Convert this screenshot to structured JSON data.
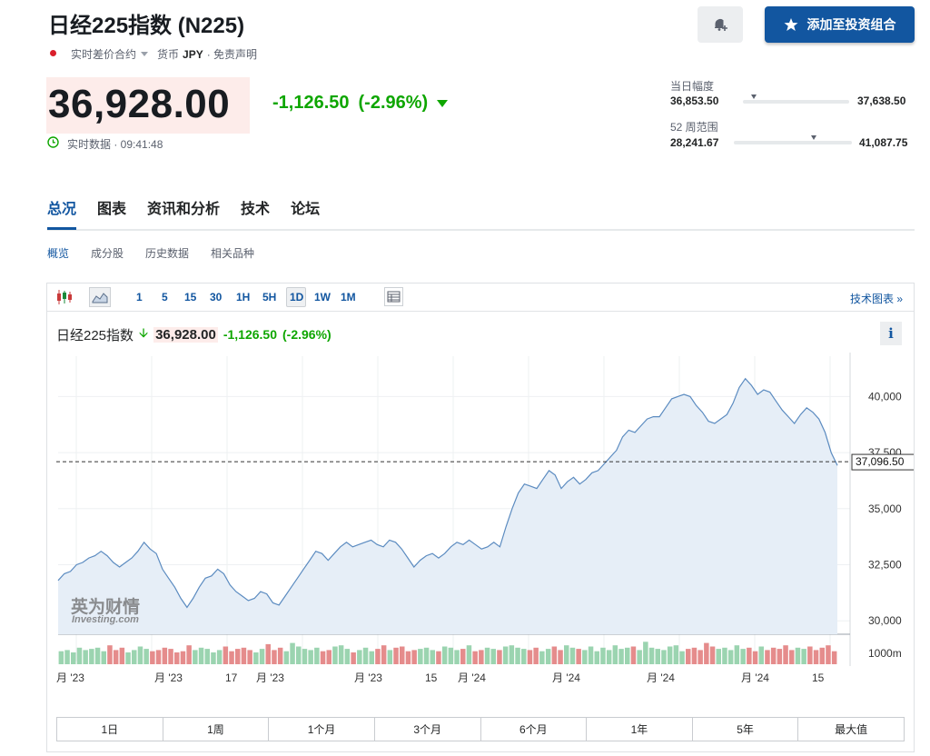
{
  "header": {
    "title": "日经225指数 (N225)",
    "instrument_type": "实时差价合约",
    "currency_label": "货币",
    "currency": "JPY",
    "disclaimer": "· 免责声明",
    "add_portfolio": "添加至投资组合"
  },
  "quote": {
    "price": "36,928.00",
    "change": "-1,126.50",
    "change_pct": "(-2.96%)",
    "realtime": "实时数据 · 09:41:48"
  },
  "ranges": {
    "day_label": "当日幅度",
    "day_low": "36,853.50",
    "day_high": "37,638.50",
    "day_position": 0.1,
    "week52_label": "52 周范围",
    "week52_low": "28,241.67",
    "week52_high": "41,087.75",
    "week52_position": 0.68
  },
  "tabs": [
    "总况",
    "图表",
    "资讯和分析",
    "技术",
    "论坛"
  ],
  "subtabs": [
    "概览",
    "成分股",
    "历史数据",
    "相关品种"
  ],
  "toolbar": {
    "timeframes": [
      "1",
      "5",
      "15",
      "30",
      "1H",
      "5H",
      "1D",
      "1W",
      "1M"
    ],
    "active": "1D",
    "tech_chart": "技术图表 »"
  },
  "chart_head": {
    "name": "日经225指数",
    "price": "36,928.00",
    "change": "-1,126.50",
    "change_pct": "(-2.96%)"
  },
  "watermark": {
    "cn": "英为财情",
    "en": "Investing.com"
  },
  "range_buttons": [
    "1日",
    "1周",
    "1个月",
    "3个月",
    "6个月",
    "1年",
    "5年",
    "最大值"
  ],
  "colors": {
    "accent": "#1256a0",
    "down": "#0ea600",
    "up_volume": "#e05a5a"
  },
  "chart_data": {
    "type": "area",
    "y_ticks": [
      "30,000",
      "32,500",
      "35,000",
      "37,500",
      "40,000"
    ],
    "ylim": [
      29400,
      41800
    ],
    "current_price": 37096.5,
    "current_label": "37,096.50",
    "volume_label": "1000m",
    "x_labels": [
      "月 '23",
      "月 '23",
      "17",
      "月 '23",
      "月 '23",
      "15",
      "月 '24",
      "月 '24",
      "月 '24",
      "月 '24",
      "15"
    ],
    "values": [
      31800,
      32100,
      32200,
      32500,
      32600,
      32800,
      32900,
      33100,
      32900,
      32600,
      32400,
      32600,
      32800,
      33100,
      33500,
      33200,
      33000,
      32300,
      31900,
      31500,
      31000,
      30600,
      31000,
      31500,
      31900,
      32000,
      32300,
      32100,
      31600,
      31300,
      31100,
      30900,
      31000,
      31300,
      31200,
      30800,
      30700,
      31100,
      31500,
      31900,
      32300,
      32700,
      33100,
      33000,
      32700,
      33000,
      33300,
      33500,
      33300,
      33400,
      33500,
      33600,
      33400,
      33300,
      33600,
      33500,
      33200,
      32800,
      32400,
      32700,
      32900,
      33000,
      32800,
      33000,
      33300,
      33500,
      33400,
      33600,
      33400,
      33200,
      33300,
      33500,
      33300,
      34200,
      35000,
      35700,
      36100,
      36000,
      35900,
      36300,
      36700,
      36500,
      35900,
      36200,
      36400,
      36100,
      36300,
      36600,
      36700,
      37000,
      37300,
      37600,
      38200,
      38500,
      38400,
      38700,
      39000,
      39100,
      39100,
      39500,
      39900,
      40000,
      40100,
      40000,
      39600,
      39300,
      38900,
      38800,
      39000,
      39200,
      39700,
      40400,
      40800,
      40500,
      40100,
      40300,
      40200,
      39800,
      39400,
      39100,
      38800,
      39200,
      39500,
      39300,
      39000,
      38400,
      37500,
      36928
    ],
    "volumes": [
      0.55,
      0.6,
      0.5,
      0.7,
      0.6,
      0.65,
      0.7,
      0.55,
      0.8,
      0.6,
      0.7,
      0.5,
      0.6,
      0.75,
      0.65,
      0.55,
      0.6,
      0.7,
      0.65,
      0.5,
      0.55,
      0.8,
      0.6,
      0.7,
      0.65,
      0.5,
      0.6,
      0.75,
      0.55,
      0.65,
      0.7,
      0.6,
      0.5,
      0.65,
      0.85,
      0.6,
      0.7,
      0.55,
      0.9,
      0.75,
      0.65,
      0.6,
      0.7,
      0.55,
      0.6,
      0.75,
      0.8,
      0.65,
      0.5,
      0.6,
      0.7,
      0.55,
      0.65,
      0.8,
      0.6,
      0.7,
      0.75,
      0.55,
      0.6,
      0.65,
      0.7,
      0.6,
      0.55,
      0.75,
      0.7,
      0.6,
      0.65,
      0.8,
      0.55,
      0.6,
      0.7,
      0.65,
      0.6,
      0.75,
      0.8,
      0.7,
      0.65,
      0.6,
      0.7,
      0.55,
      0.65,
      0.75,
      0.6,
      0.8,
      0.7,
      0.65,
      0.6,
      0.75,
      0.55,
      0.7,
      0.6,
      0.8,
      0.65,
      0.7,
      0.75,
      0.6,
      0.95,
      0.7,
      0.65,
      0.6,
      0.75,
      0.8,
      0.55,
      0.65,
      0.7,
      0.6,
      0.9,
      0.75,
      0.65,
      0.7,
      0.6,
      0.8,
      0.65,
      0.7,
      0.55,
      0.75,
      0.6,
      0.7,
      0.65,
      0.8,
      0.6,
      0.7,
      0.65,
      0.75,
      0.6,
      0.7,
      0.8,
      0.55
    ]
  }
}
